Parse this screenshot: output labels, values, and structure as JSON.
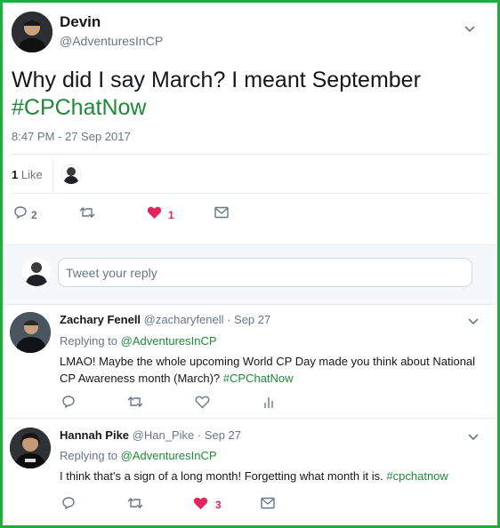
{
  "tweet": {
    "author_name": "Devin",
    "author_handle": "@AdventuresInCP",
    "text": "Why did I say March? I meant September",
    "hashtag": "#CPChatNow",
    "timestamp": "8:47 PM - 27 Sep 2017",
    "likes_count": "1",
    "likes_label": "Like",
    "reply_count": "2",
    "heart_count": "1"
  },
  "reply_box": {
    "placeholder": "Tweet your reply"
  },
  "replies": [
    {
      "name": "Zachary Fenell",
      "handle": "@zacharyfenell",
      "date": "· Sep 27",
      "replying_prefix": "Replying to",
      "replying_to": "@AdventuresInCP",
      "text": "LMAO! Maybe the whole upcoming World CP Day made you think about National CP Awareness month (March)?",
      "hashtag": "#CPChatNow"
    },
    {
      "name": "Hannah Pike",
      "handle": "@Han_Pike",
      "date": "· Sep 27",
      "replying_prefix": "Replying to",
      "replying_to": "@AdventuresInCP",
      "text": "I think that's a sign of a long month! Forgetting what month it is.",
      "hashtag": "#cpchatnow",
      "heart_count": "3"
    }
  ],
  "colors": {
    "border": "#1fae3b",
    "hashtag": "#1c8a36",
    "heart": "#e0245e",
    "muted": "#657786"
  }
}
